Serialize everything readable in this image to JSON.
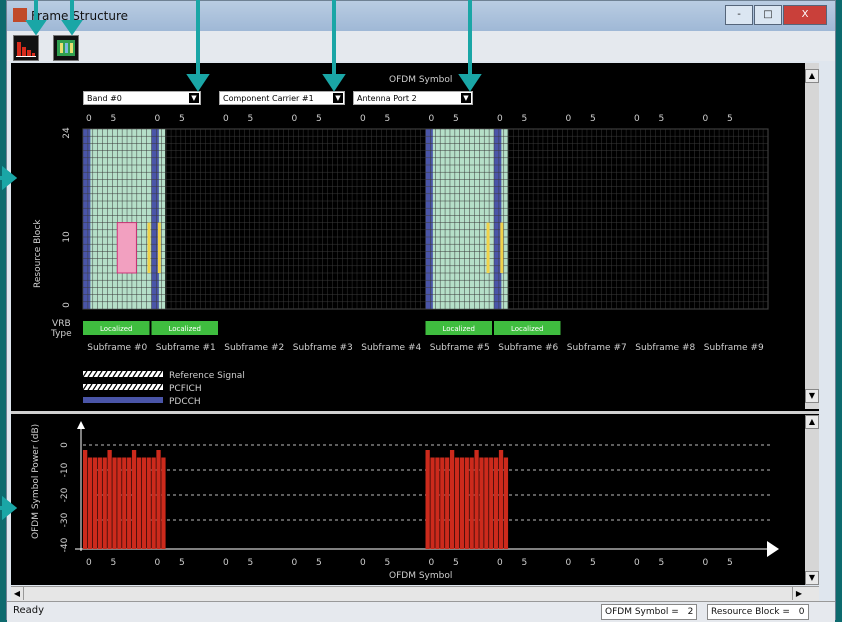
{
  "window": {
    "title": "Frame Structure",
    "buttons": {
      "minimize": "-",
      "maximize": "□",
      "close": "X"
    }
  },
  "toolbar": {
    "buttons": [
      {
        "name": "bar-chart-icon"
      },
      {
        "name": "table-icon"
      }
    ]
  },
  "upper_plot": {
    "axis_title": "OFDM Symbol",
    "y_label": "Resource Block",
    "y_ticks": [
      "24",
      "10",
      "0"
    ],
    "x_tick_labels": [
      "0",
      "5",
      "0",
      "5",
      "0",
      "5",
      "0",
      "5",
      "0",
      "5",
      "0",
      "5",
      "0",
      "5",
      "0",
      "5",
      "0",
      "5",
      "0",
      "5"
    ],
    "dropdowns": [
      {
        "value": "Band #0"
      },
      {
        "value": "Component Carrier #1"
      },
      {
        "value": "Antenna Port 2"
      }
    ],
    "vrb_label": "VRB",
    "type_label": "Type",
    "localized_tags": [
      "Localized",
      "Localized",
      "Localized",
      "Localized"
    ],
    "subframes": [
      "Subframe #0",
      "Subframe #1",
      "Subframe #2",
      "Subframe #3",
      "Subframe #4",
      "Subframe #5",
      "Subframe #6",
      "Subframe #7",
      "Subframe #8",
      "Subframe #9"
    ],
    "legend": [
      {
        "label": "Reference Signal",
        "color": "#ffffff"
      },
      {
        "label": "PCFICH",
        "color": "#ffffff"
      },
      {
        "label": "PDCCH",
        "color": "#4a55a8"
      }
    ]
  },
  "lower_plot": {
    "y_label": "OFDM Symbol Power (dB)",
    "y_ticks": [
      "0",
      "-10",
      "-20",
      "-30",
      "-40"
    ],
    "x_label": "OFDM Symbol",
    "x_tick_labels": [
      "0",
      "5",
      "0",
      "5",
      "0",
      "5",
      "0",
      "5",
      "0",
      "5",
      "0",
      "5",
      "0",
      "5",
      "0",
      "5",
      "0",
      "5",
      "0",
      "5"
    ],
    "bar_color": "#cc2a1c"
  },
  "status": {
    "ready": "Ready",
    "ofdm_symbol": "OFDM Symbol =",
    "ofdm_symbol_value": "2",
    "resource_block": "Resource Block =",
    "resource_block_value": "0"
  },
  "colors": {
    "teal_arrow": "#1aa6a6",
    "grid_green": "#b5dfc8",
    "pink": "#f2a0c0",
    "yellow": "#f0d24a",
    "localized_green": "#3fbd3f"
  }
}
